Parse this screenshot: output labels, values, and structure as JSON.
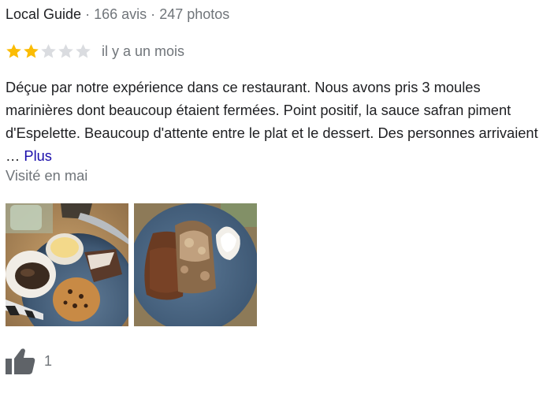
{
  "reviewer": {
    "badge": "Local Guide",
    "separator": "·",
    "reviews_count": "166 avis",
    "photos_count": "247 photos"
  },
  "rating": {
    "stars_filled": 2,
    "stars_total": 5,
    "time_ago": "il y a un mois"
  },
  "review": {
    "text": "Déçue par notre expérience dans ce restaurant. Nous avons pris 3 moules marinières dont beaucoup étaient fermées. Point positif, la sauce safran piment d'Espelette. Beaucoup d'attente entre le plat et le dessert. Des personnes arrivaient …",
    "more_label": "Plus",
    "visited": "Visité en mai"
  },
  "photos": [
    {
      "icon": "dessert-plate-photo"
    },
    {
      "icon": "chocolate-cake-photo"
    }
  ],
  "likes": {
    "icon": "thumbs-up-icon",
    "count": "1"
  },
  "colors": {
    "star_filled": "#fbbc04",
    "star_empty": "#dadce0",
    "link": "#1a0dab",
    "muted_text": "#70757a",
    "text": "#202124",
    "thumb": "#5f6368"
  }
}
